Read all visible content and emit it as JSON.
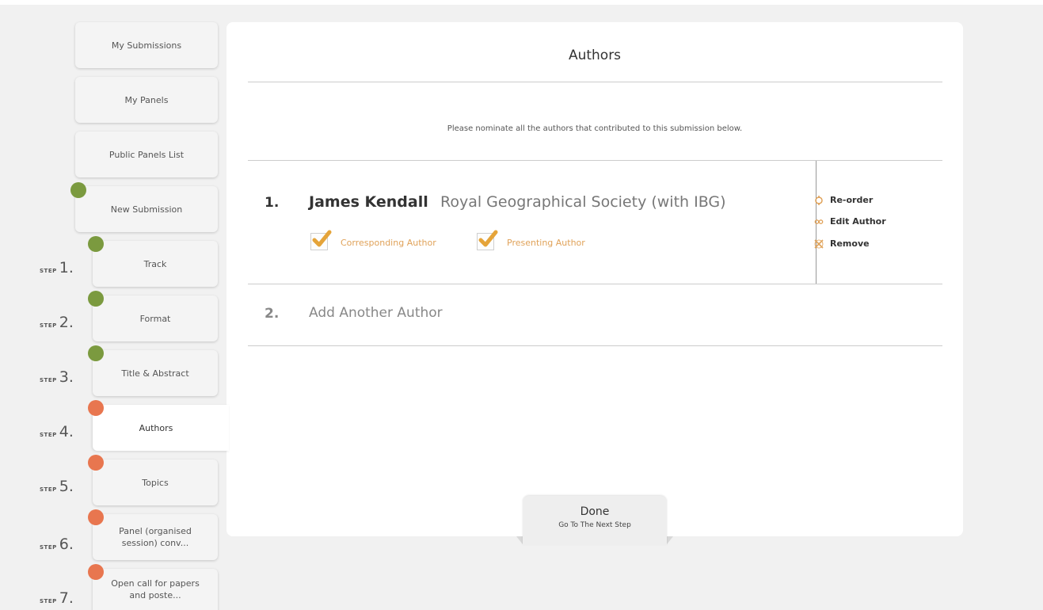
{
  "nav": {
    "my_submissions": "My Submissions",
    "my_panels": "My Panels",
    "public_panels": "Public Panels List",
    "new_submission": "New Submission"
  },
  "steps": [
    {
      "step_word": "STEP",
      "number": "1.",
      "label": "Track",
      "status": "complete"
    },
    {
      "step_word": "STEP",
      "number": "2.",
      "label": "Format",
      "status": "complete"
    },
    {
      "step_word": "STEP",
      "number": "3.",
      "label": "Title & Abstract",
      "status": "complete"
    },
    {
      "step_word": "STEP",
      "number": "4.",
      "label": "Authors",
      "status": "current"
    },
    {
      "step_word": "STEP",
      "number": "5.",
      "label": "Topics",
      "status": "incomplete"
    },
    {
      "step_word": "STEP",
      "number": "6.",
      "label_line1": "Panel (organised",
      "label_line2": "session) conv...",
      "status": "incomplete"
    },
    {
      "step_word": "STEP",
      "number": "7.",
      "label_line1": "Open call for papers",
      "label_line2": "and poste...",
      "status": "incomplete"
    }
  ],
  "colors": {
    "complete": "#7b9a3f",
    "incomplete": "#e8764f",
    "checkbox_label": "#e0a259",
    "checkmark": "#e5a43a"
  },
  "panel": {
    "title": "Authors",
    "intro": "Please nominate all the authors that contributed to this submission below."
  },
  "authors": [
    {
      "number": "1.",
      "name": "James Kendall",
      "organisation": "Royal Geographical Society (with IBG)",
      "corresponding_label": "Corresponding Author",
      "corresponding": true,
      "presenting_label": "Presenting Author",
      "presenting": true
    }
  ],
  "actions": {
    "reorder": "Re-order",
    "edit": "Edit Author",
    "remove": "Remove"
  },
  "add_author": {
    "number": "2.",
    "label": "Add Another Author"
  },
  "done": {
    "label": "Done",
    "sublabel": "Go To The Next Step"
  },
  "icons": [
    "reorder-icon",
    "edit-author-icon",
    "remove-icon",
    "checkmark-icon",
    "status-dot-icon"
  ]
}
